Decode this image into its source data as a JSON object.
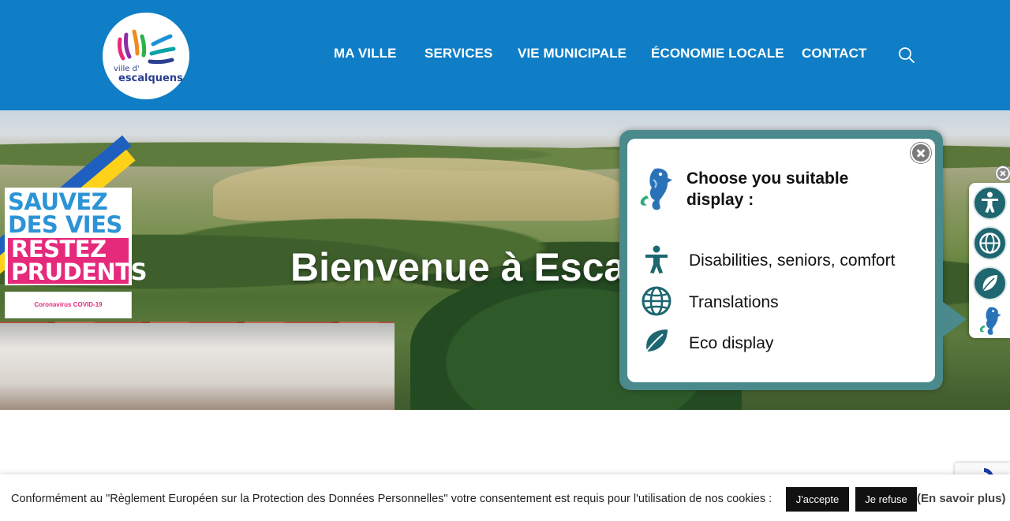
{
  "header": {
    "logo": {
      "line1": "ville d'",
      "line2": "escalquens"
    },
    "nav": [
      {
        "label": "MA VILLE"
      },
      {
        "label": "SERVICES"
      },
      {
        "label": "VIE MUNICIPALE"
      },
      {
        "label": "ÉCONOMIE LOCALE"
      },
      {
        "label": "CONTACT"
      }
    ],
    "search_icon": "search-icon"
  },
  "hero": {
    "title": "Bienvenue à Escalq",
    "covid": {
      "line1": "SAUVEZ",
      "line2": "DES VIES",
      "line3": "RESTEZ",
      "line4": "PRUDENTS",
      "footer": "Coronavirus COVID-19"
    }
  },
  "popup": {
    "title": "Choose you suitable display :",
    "options": [
      {
        "label": "Disabilities, seniors, comfort",
        "icon": "accessibility-person-icon"
      },
      {
        "label": "Translations",
        "icon": "globe-icon"
      },
      {
        "label": "Eco display",
        "icon": "leaf-icon"
      }
    ],
    "accent": "#4b8a8c"
  },
  "side_toolbar": {
    "buttons": [
      "accessibility-person-icon",
      "globe-icon",
      "leaf-icon",
      "seahorse-icon"
    ],
    "color": "#1e6670"
  },
  "cookie": {
    "text": "Conformément au \"Règlement Européen sur la Protection des Données Personnelles\" votre consentement est requis pour l'utilisation de nos cookies :",
    "accept_label": "J'accepte",
    "refuse_label": "Je refuse",
    "more_label": "(En savoir plus)"
  },
  "colors": {
    "header_bg": "#0f7ec6",
    "covid_pink": "#e5297b",
    "covid_blue": "#2c94d6"
  }
}
